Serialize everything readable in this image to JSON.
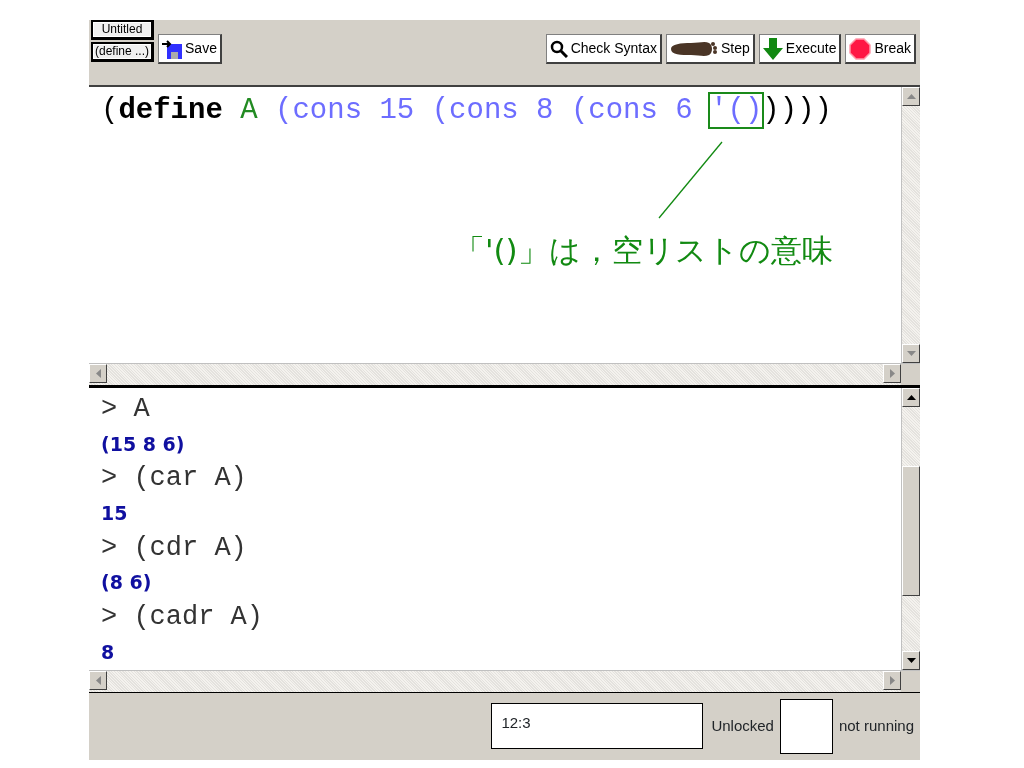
{
  "toolbar": {
    "file_buttons": [
      {
        "label": "Untitled"
      },
      {
        "label": "(define ...)"
      }
    ],
    "buttons": [
      {
        "label": "Save",
        "kind": "save"
      },
      {
        "label": "Check Syntax",
        "kind": "check"
      },
      {
        "label": "Step",
        "kind": "step"
      },
      {
        "label": "Execute",
        "kind": "execute"
      },
      {
        "label": "Break",
        "kind": "break"
      }
    ]
  },
  "definitions": {
    "tokens": [
      {
        "text": "(",
        "kind": "paren",
        "highlighted": false
      },
      {
        "text": "define",
        "kind": "keyword",
        "highlighted": false
      },
      {
        "text": " A",
        "kind": "variable",
        "highlighted": false
      },
      {
        "text": " (cons 15 (cons 8 (cons 6 ",
        "kind": "constant",
        "highlighted": false
      },
      {
        "text": "'()",
        "kind": "constant",
        "highlighted": true
      },
      {
        "text": "))))",
        "kind": "paren",
        "highlighted": false
      }
    ],
    "annotation": "「'()」は，空リストの意味"
  },
  "interactions": [
    {
      "text": "> A",
      "kind": "prompt"
    },
    {
      "text": "(15 8 6)",
      "kind": "result"
    },
    {
      "text": "> (car A)",
      "kind": "prompt"
    },
    {
      "text": "15",
      "kind": "result"
    },
    {
      "text": "> (cdr A)",
      "kind": "prompt"
    },
    {
      "text": "(8 6)",
      "kind": "result"
    },
    {
      "text": "> (cadr A)",
      "kind": "prompt"
    },
    {
      "text": "8",
      "kind": "result"
    }
  ],
  "status_bar": {
    "position": "12:3",
    "lock": "Unlocked",
    "state": "not running"
  }
}
